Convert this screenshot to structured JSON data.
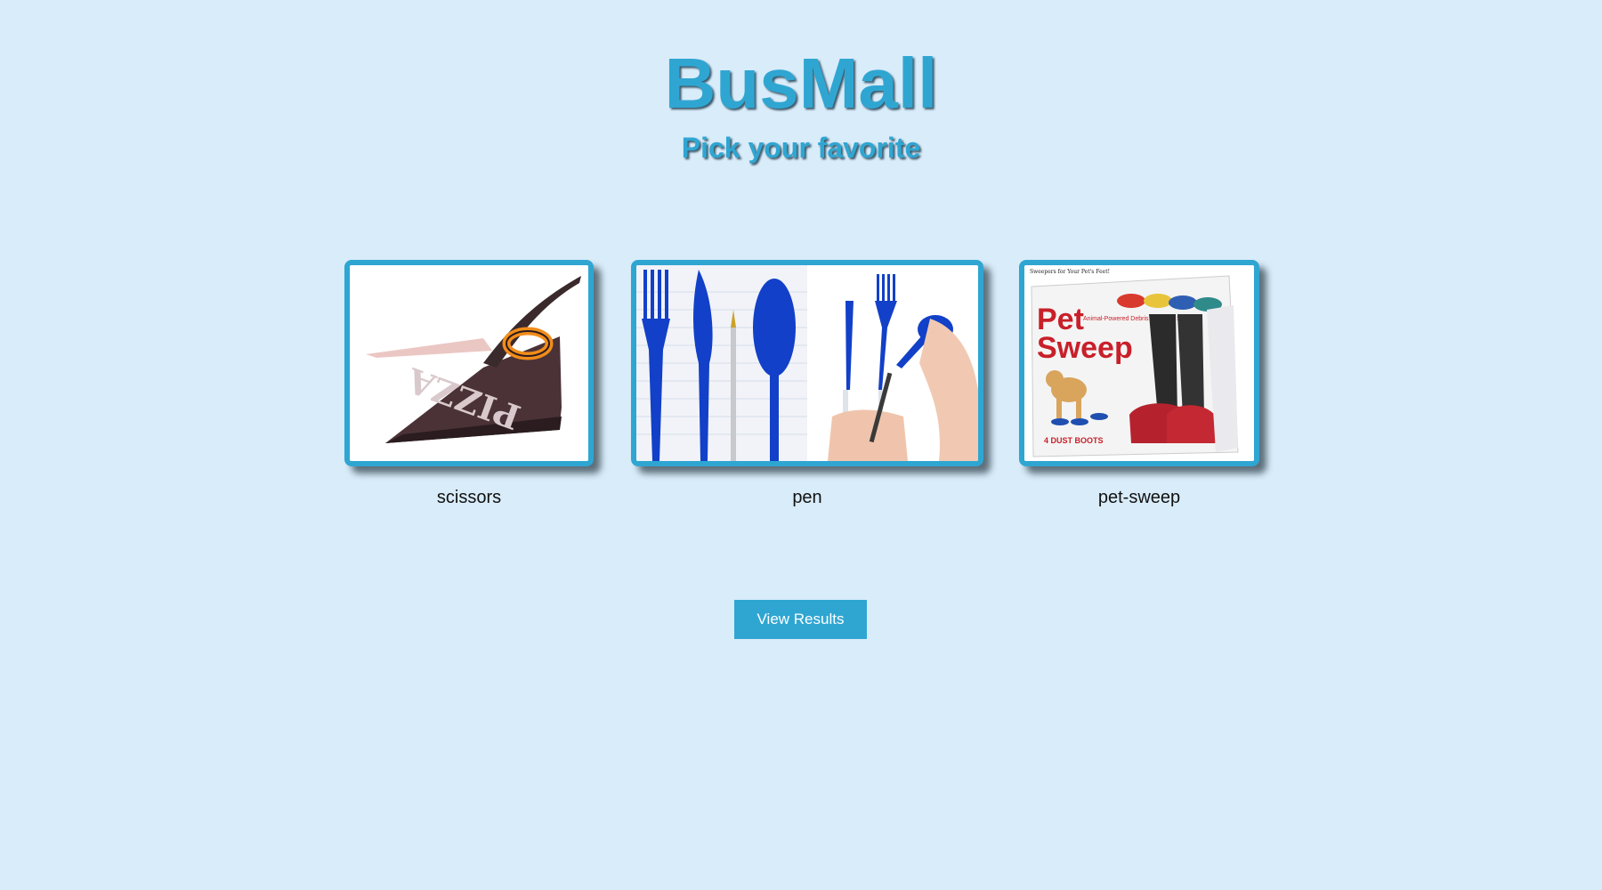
{
  "app": {
    "title": "BusMall",
    "subtitle": "Pick your favorite"
  },
  "products": [
    {
      "name": "scissors",
      "image_icon": "pizza-scissors-image"
    },
    {
      "name": "pen",
      "image_icon": "pen-utensils-image"
    },
    {
      "name": "pet-sweep",
      "image_icon": "pet-sweep-box-image",
      "image_text": {
        "tag": "Sweepers for Your Pet's Feet!",
        "brand_line1": "Pet",
        "brand_line2": "Sweep",
        "tagline": "Animal-Powered Debris Removal System",
        "boots": "4 DUST BOOTS"
      }
    }
  ],
  "actions": {
    "view_results_label": "View Results"
  },
  "colors": {
    "background": "#d9ecfa",
    "accent": "#2fa6d2",
    "title_shadow": "#3a5566"
  }
}
